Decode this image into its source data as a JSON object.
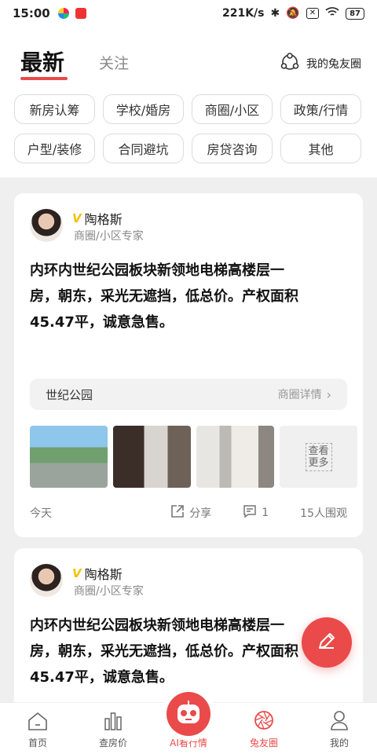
{
  "status_bar": {
    "time": "15:00",
    "net_speed": "221K/s",
    "battery": "87"
  },
  "header": {
    "tab_latest": "最新",
    "tab_follow": "关注",
    "circle_link": "我的兔友圈"
  },
  "tags": [
    "新房认筹",
    "学校/婚房",
    "商圈/小区",
    "政策/行情",
    "户型/装修",
    "合同避坑",
    "房贷咨询",
    "其他"
  ],
  "posts": [
    {
      "author": "陶格斯",
      "badge": "V",
      "role": "商圈/小区专家",
      "text": "内环内世纪公园板块新领地电梯高楼层一\n房，朝东，采光无遮挡，低总价。产权面积\n45.47平，诚意急售。",
      "district": "世纪公园",
      "district_more": "商圈详情",
      "more_photos": "查看更多",
      "date": "今天",
      "share": "分享",
      "comments": "1",
      "views": "15人围观"
    },
    {
      "author": "陶格斯",
      "badge": "V",
      "role": "商圈/小区专家",
      "text": "内环内世纪公园板块新领地电梯高楼层一\n房，朝东，采光无遮挡，低总价。产权面积\n45.47平，诚意急售。"
    }
  ],
  "bottom_nav": [
    {
      "label": "首页",
      "icon": "home-icon"
    },
    {
      "label": "查房价",
      "icon": "bar-chart-icon"
    },
    {
      "label": "AI看行情",
      "icon": "ai-robot-icon"
    },
    {
      "label": "兔友圈",
      "icon": "aperture-icon"
    },
    {
      "label": "我的",
      "icon": "person-icon"
    }
  ],
  "colors": {
    "accent": "#e84a4a",
    "badge": "#f2c200"
  }
}
